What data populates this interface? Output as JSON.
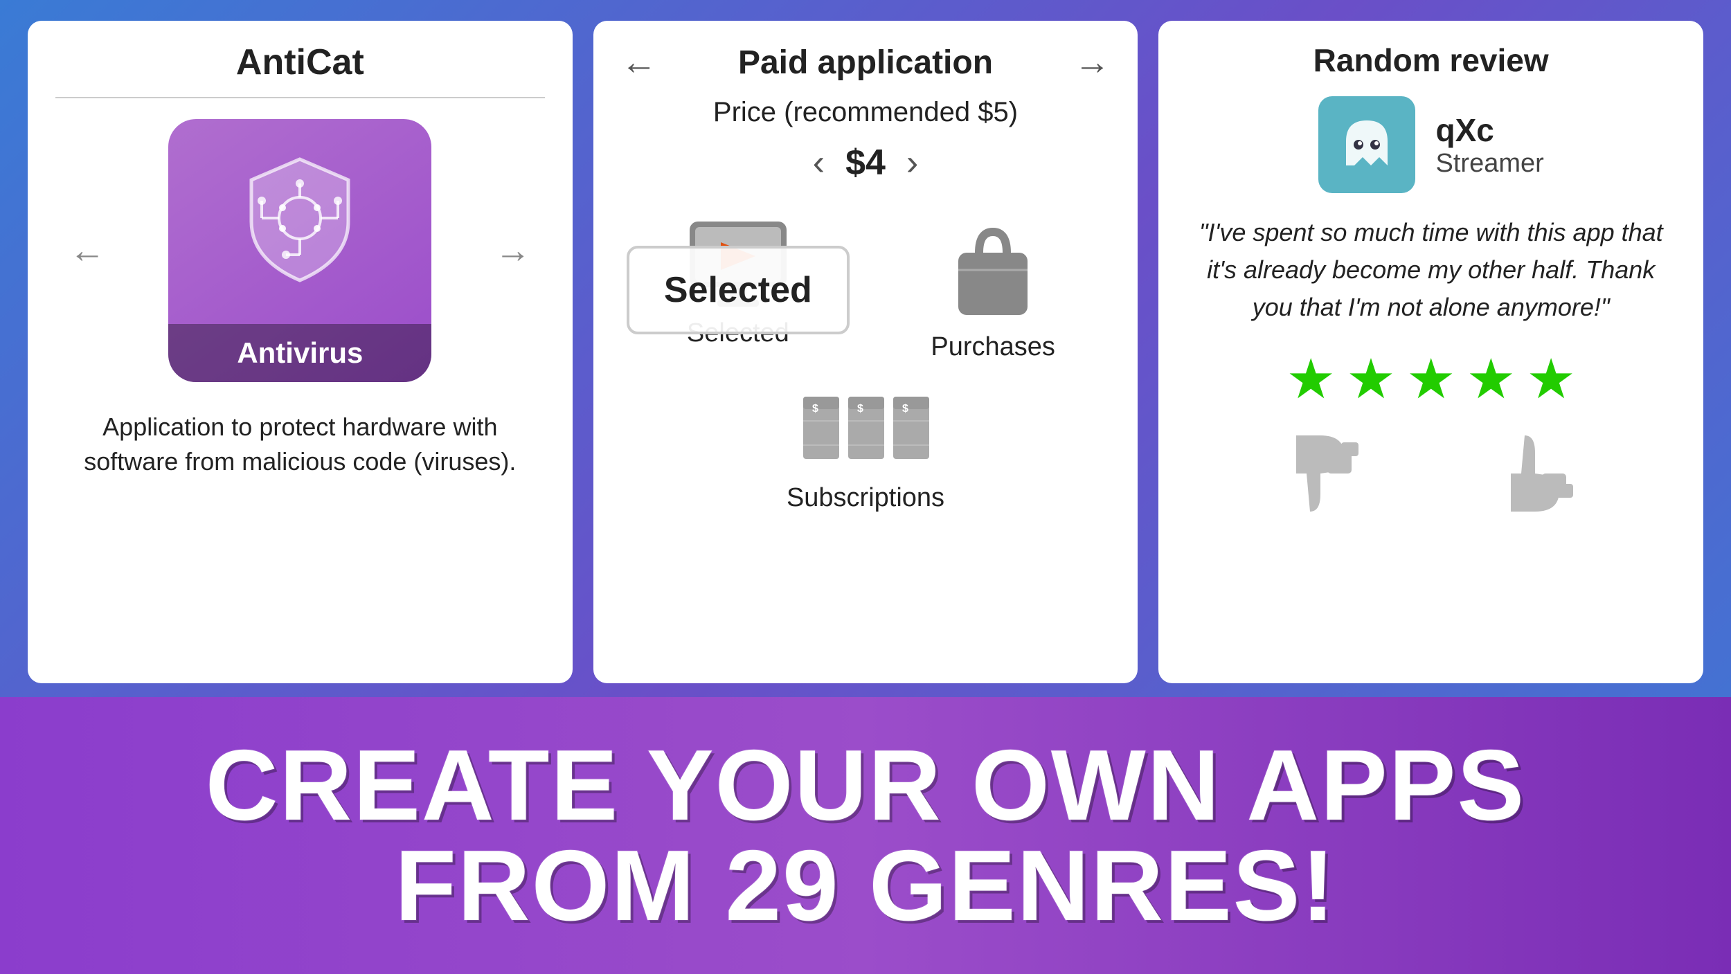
{
  "background": {
    "gradient": "linear-gradient(135deg, #3a7bd5 0%, #6a4fc8 50%, #3a7bd5 100%)"
  },
  "card1": {
    "title": "AntiCat",
    "app_category": "Antivirus",
    "app_description": "Application to protect hardware with software from malicious code (viruses).",
    "left_arrow": "←",
    "right_arrow": "→"
  },
  "card2": {
    "header_title": "Paid application",
    "left_arrow": "←",
    "right_arrow": "→",
    "price_label": "Price (recommended $5)",
    "price_value": "$4",
    "price_left": "‹",
    "price_right": "›",
    "option1_label": "Selected",
    "option2_label": "Purchases",
    "option3_label": "Subscriptions"
  },
  "card3": {
    "section_title": "Random review",
    "app_name": "qXc",
    "app_category": "Streamer",
    "review_text": "\"I've spent so much time with this app that it's already become my other half. Thank you that I'm not alone anymore!\"",
    "stars": [
      "★",
      "★",
      "★",
      "★",
      "★"
    ],
    "thumbs_down": "👎",
    "thumbs_up": "👍"
  },
  "banner": {
    "line1": "CREATE YOUR OWN APPS",
    "line2": "FROM 29 GENRES!"
  }
}
